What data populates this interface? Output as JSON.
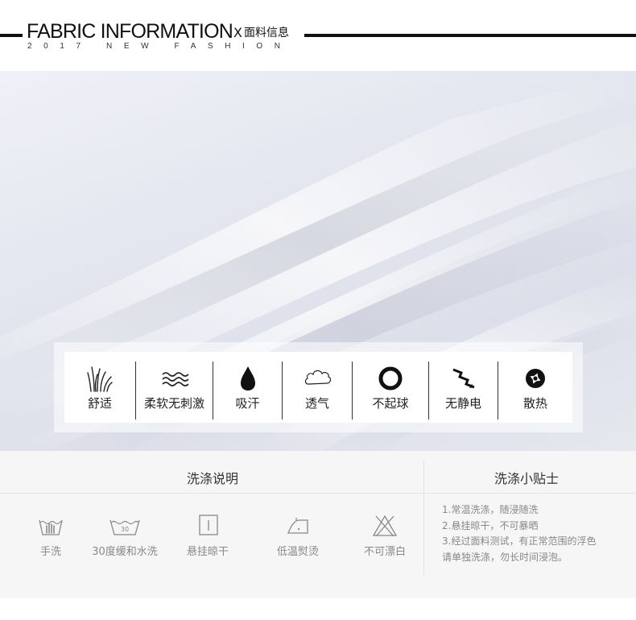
{
  "header": {
    "title": "FABRIC INFORMATION",
    "title_x": "X",
    "title_cn": "面料信息",
    "subtitle": "2017 NEW FASHION"
  },
  "features": [
    {
      "label": "舒适",
      "icon": "grass-icon"
    },
    {
      "label": "柔软无刺激",
      "icon": "waves-icon"
    },
    {
      "label": "吸汗",
      "icon": "water-drop-icon"
    },
    {
      "label": "透气",
      "icon": "cloud-icon"
    },
    {
      "label": "不起球",
      "icon": "ring-icon"
    },
    {
      "label": "无静电",
      "icon": "lightning-icon"
    },
    {
      "label": "散热",
      "icon": "aperture-icon"
    }
  ],
  "care": {
    "wash_title": "洗涤说明",
    "tips_title": "洗涤小贴士",
    "wash_items": [
      {
        "label": "手洗",
        "icon": "hand-wash-icon"
      },
      {
        "label": "30度缓和水洗",
        "icon": "wash-30-icon",
        "icon_text": "30"
      },
      {
        "label": "悬挂晾干",
        "icon": "hang-dry-icon"
      },
      {
        "label": "低温熨烫",
        "icon": "iron-low-icon"
      },
      {
        "label": "不可漂白",
        "icon": "no-bleach-icon"
      }
    ],
    "tips": [
      "1.常温洗涤，随浸随洗",
      "2.悬挂晾干，不可暴晒",
      "3.经过面料测试，有正常范围的浮色",
      "请单独洗涤，勿长时间浸泡。"
    ]
  },
  "colors": {
    "ink": "#111111",
    "care_background": "#f6f6f6",
    "muted_text": "#888888"
  }
}
